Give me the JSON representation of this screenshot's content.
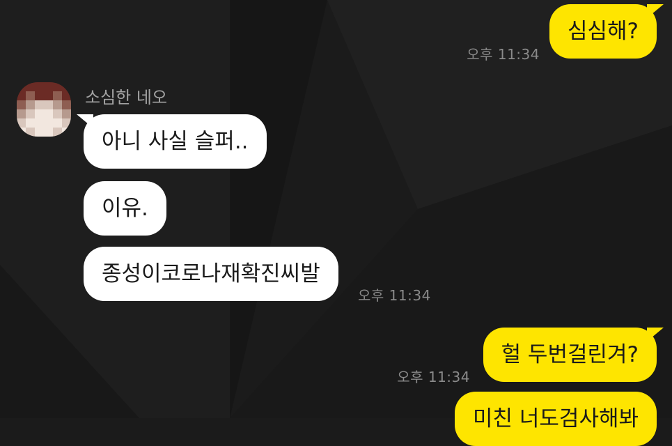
{
  "chat": {
    "messages": [
      {
        "direction": "out",
        "text": "심심해?",
        "time": "오후 11:34"
      },
      {
        "direction": "in",
        "sender": "소심한 네오",
        "text": "아니 사실 슬퍼.."
      },
      {
        "direction": "in",
        "text": "이유."
      },
      {
        "direction": "in",
        "text": "종성이코로나재확진씨발",
        "time": "오후 11:34"
      },
      {
        "direction": "out",
        "text": "헐 두번걸린겨?",
        "time": "오후 11:34"
      },
      {
        "direction": "out",
        "text": "미친 너도검사해봐"
      }
    ],
    "avatar": {
      "description_colors": [
        "#6b2b25",
        "#8e5e52",
        "#b69a8e",
        "#d9c7bd",
        "#f2e7df"
      ]
    }
  },
  "theme": {
    "background": "#1b1b1b",
    "incoming_bubble": "#ffffff",
    "outgoing_bubble": "#fee500",
    "timestamp": "#8a8a8a",
    "sender_name": "#a3a3a3"
  }
}
